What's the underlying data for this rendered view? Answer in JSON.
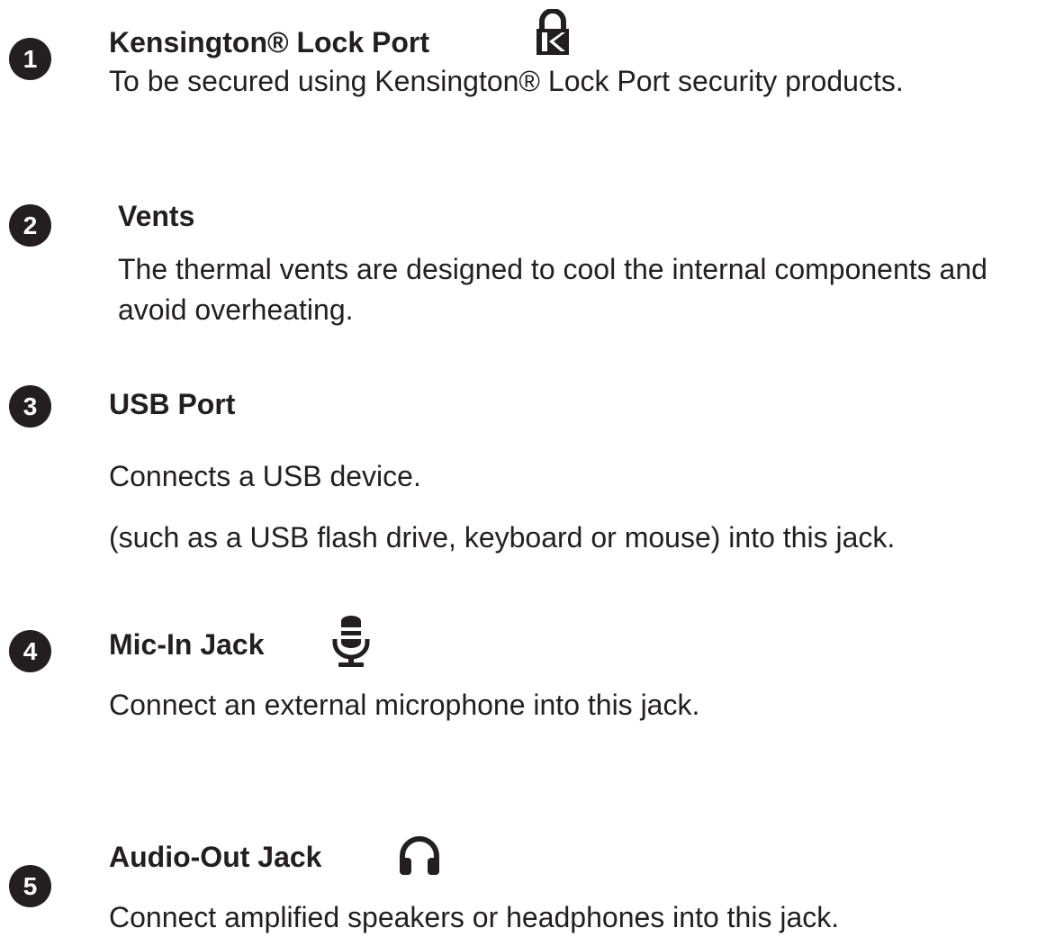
{
  "items": [
    {
      "number": "1",
      "title": "Kensington® Lock Port",
      "icon": "kensington-lock-icon",
      "lines": [
        "To be secured using Kensington® Lock Port security products."
      ]
    },
    {
      "number": "2",
      "title": "Vents",
      "lines": [
        "The thermal vents are designed to cool the internal components and",
        "avoid overheating."
      ]
    },
    {
      "number": "3",
      "title": "USB Port",
      "lines": [
        "Connects a USB device.",
        "(such as a USB flash drive, keyboard or mouse) into this jack."
      ]
    },
    {
      "number": "4",
      "title": "Mic-In Jack",
      "icon": "microphone-icon",
      "lines": [
        "Connect an external microphone into this jack."
      ]
    },
    {
      "number": "5",
      "title": "Audio-Out Jack",
      "icon": "headphones-icon",
      "lines": [
        "Connect amplified speakers or headphones into this jack."
      ]
    }
  ],
  "colors": {
    "text": "#231f20",
    "badge_background": "#231f20",
    "badge_text": "#ffffff"
  }
}
